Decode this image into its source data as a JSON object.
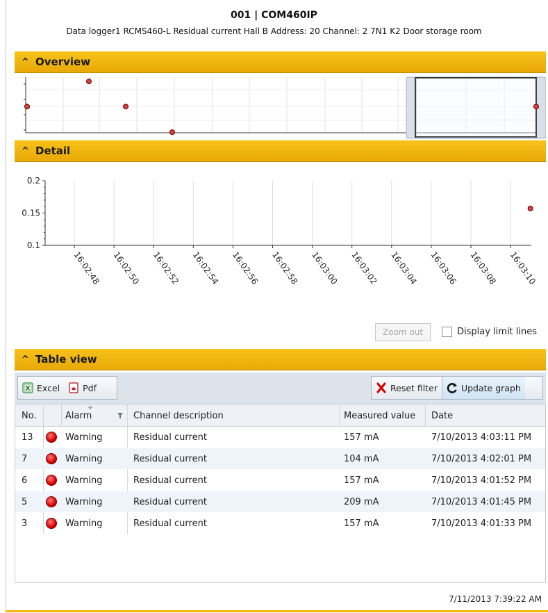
{
  "header": {
    "title": "001 | COM460IP",
    "subtitle": "Data logger1  RCMS460-L Residual current Hall B  Address: 20  Channel: 2  7N1 K2 Door storage room"
  },
  "sections": {
    "overview": "Overview",
    "detail": "Detail",
    "table_view": "Table view"
  },
  "icons": {
    "section_chevron": "chevron-up-icon",
    "excel": "excel-icon",
    "pdf": "pdf-icon",
    "reset": "red-x-icon",
    "update": "refresh-icon",
    "alarm": "red-alarm-dot-icon",
    "filter": "filter-icon"
  },
  "colors": {
    "section_bar": "#f2b50f",
    "alarm": "#e00000",
    "point": "#e04040"
  },
  "chart_data": [
    {
      "type": "scatter",
      "name": "overview",
      "y_ticks": [
        "",
        "",
        "",
        ""
      ],
      "points_y_ma": [
        157,
        209,
        157,
        104,
        157
      ],
      "selection_window": "right-side"
    },
    {
      "type": "scatter",
      "name": "detail",
      "y_ticks": [
        "0.2",
        "0.15",
        "0.1"
      ],
      "ylim": [
        0.1,
        0.2
      ],
      "x_ticks": [
        "16:02:48",
        "16:02:50",
        "16:02:52",
        "16:02:54",
        "16:02:56",
        "16:02:58",
        "16:03:00",
        "16:03:02",
        "16:03:04",
        "16:03:06",
        "16:03:08",
        "16:03:10"
      ],
      "points": [
        {
          "x": "16:03:11",
          "y": 0.157
        }
      ]
    }
  ],
  "controls": {
    "zoom_out": "Zoom out",
    "display_limit_lines": "Display limit lines",
    "display_limit_lines_checked": false
  },
  "toolbar": {
    "excel": "Excel",
    "pdf": "Pdf",
    "reset_filter": "Reset filter",
    "update_graph": "Update graph"
  },
  "table": {
    "columns": [
      "No.",
      "Alarm",
      "Channel description",
      "Measured value",
      "Date"
    ],
    "rows": [
      {
        "no": "13",
        "alarm": "Warning",
        "desc": "Residual current",
        "value": "157 mA",
        "date": "7/10/2013 4:03:11 PM"
      },
      {
        "no": "7",
        "alarm": "Warning",
        "desc": "Residual current",
        "value": "104 mA",
        "date": "7/10/2013 4:02:01 PM"
      },
      {
        "no": "6",
        "alarm": "Warning",
        "desc": "Residual current",
        "value": "157 mA",
        "date": "7/10/2013 4:01:52 PM"
      },
      {
        "no": "5",
        "alarm": "Warning",
        "desc": "Residual current",
        "value": "209 mA",
        "date": "7/10/2013 4:01:45 PM"
      },
      {
        "no": "3",
        "alarm": "Warning",
        "desc": "Residual current",
        "value": "157 mA",
        "date": "7/10/2013 4:01:33 PM"
      }
    ]
  },
  "footer": {
    "timestamp": "7/11/2013 7:39:22 AM"
  }
}
